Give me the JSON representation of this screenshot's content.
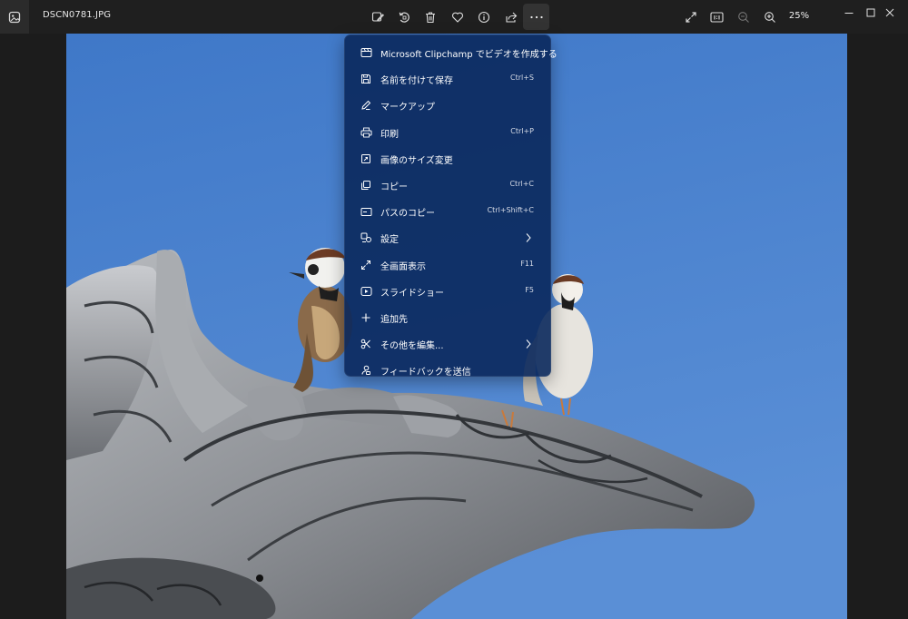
{
  "window": {
    "filename": "DSCN0781.JPG",
    "zoom": "25%"
  },
  "toolbar": {
    "buttons": [
      {
        "name": "edit-image-button",
        "icon": "edit-image-icon"
      },
      {
        "name": "rotate-button",
        "icon": "rotate-icon"
      },
      {
        "name": "delete-button",
        "icon": "trash-icon"
      },
      {
        "name": "favorite-button",
        "icon": "heart-icon"
      },
      {
        "name": "file-info-button",
        "icon": "info-icon"
      },
      {
        "name": "share-button",
        "icon": "share-icon"
      },
      {
        "name": "more-options-button",
        "icon": "ellipsis-icon"
      }
    ],
    "view_buttons": [
      {
        "name": "fit-to-window-button",
        "icon": "expand-icon"
      },
      {
        "name": "actual-size-button",
        "icon": "actual-size-icon",
        "text": "1:1"
      },
      {
        "name": "zoom-out-button",
        "icon": "zoom-out-icon"
      },
      {
        "name": "zoom-in-button",
        "icon": "zoom-in-icon"
      }
    ]
  },
  "menu": {
    "items": [
      {
        "label": "Microsoft Clipchamp でビデオを作成する",
        "shortcut": "",
        "icon": "video-editor-icon",
        "submenu": false
      },
      {
        "label": "名前を付けて保存",
        "shortcut": "Ctrl+S",
        "icon": "save-icon",
        "submenu": false
      },
      {
        "label": "マークアップ",
        "shortcut": "",
        "icon": "markup-pen-icon",
        "submenu": false
      },
      {
        "label": "印刷",
        "shortcut": "Ctrl+P",
        "icon": "print-icon",
        "submenu": false
      },
      {
        "label": "画像のサイズ変更",
        "shortcut": "",
        "icon": "resize-image-icon",
        "submenu": false
      },
      {
        "label": "コピー",
        "shortcut": "Ctrl+C",
        "icon": "copy-icon",
        "submenu": false
      },
      {
        "label": "パスのコピー",
        "shortcut": "Ctrl+Shift+C",
        "icon": "copy-path-icon",
        "submenu": false
      },
      {
        "label": "設定",
        "shortcut": "",
        "icon": "settings-icon",
        "submenu": true
      },
      {
        "label": "全画面表示",
        "shortcut": "F11",
        "icon": "fullscreen-icon",
        "submenu": false
      },
      {
        "label": "スライドショー",
        "shortcut": "F5",
        "icon": "slideshow-icon",
        "submenu": false
      },
      {
        "label": "追加先",
        "shortcut": "",
        "icon": "add-icon",
        "submenu": false
      },
      {
        "label": "その他を編集...",
        "shortcut": "",
        "icon": "edit-more-icon",
        "submenu": true
      },
      {
        "label": "フィードバックを送信",
        "shortcut": "",
        "icon": "feedback-icon",
        "submenu": false
      }
    ]
  },
  "colors": {
    "titlebar": "#1f1f1f",
    "menu_background": "#0a285c",
    "sky": "#4a82d0"
  }
}
